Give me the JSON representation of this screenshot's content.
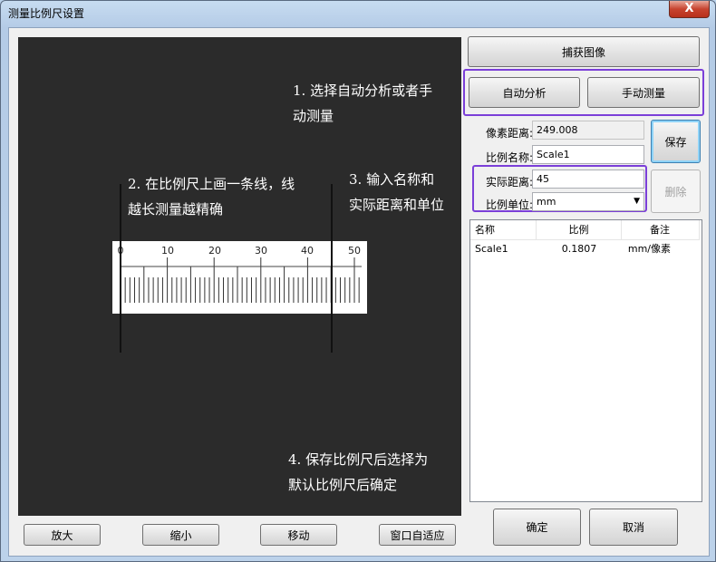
{
  "window": {
    "title": "测量比例尺设置",
    "close_label": "X"
  },
  "canvas": {
    "notes": [
      "1. 选择自动分析或者手\n动测量",
      "2. 在比例尺上画一条线，线\n越长测量越精确",
      "3. 输入名称和\n实际距离和单位",
      "4. 保存比例尺后选择为\n默认比例尺后确定"
    ],
    "ruler_ticks": [
      "0",
      "10",
      "20",
      "30",
      "40",
      "50"
    ]
  },
  "right_panel": {
    "capture_button": "捕获图像",
    "auto_analyze_button": "自动分析",
    "manual_measure_button": "手动测量",
    "pixel_distance_label": "像素距离:",
    "pixel_distance_value": "249.008",
    "scale_name_label": "比例名称:",
    "scale_name_value": "Scale1",
    "actual_distance_label": "实际距离:",
    "actual_distance_value": "45",
    "scale_unit_label": "比例单位:",
    "scale_unit_value": "mm",
    "save_button": "保存",
    "delete_button": "删除"
  },
  "table": {
    "headers": [
      "名称",
      "比例",
      "备注"
    ],
    "rows": [
      [
        "Scale1",
        "0.1807",
        "mm/像素"
      ]
    ]
  },
  "bottom_buttons": {
    "zoom_in": "放大",
    "zoom_out": "缩小",
    "move": "移动",
    "fit_window": "窗口自适应",
    "ok": "确定",
    "cancel": "取消"
  }
}
